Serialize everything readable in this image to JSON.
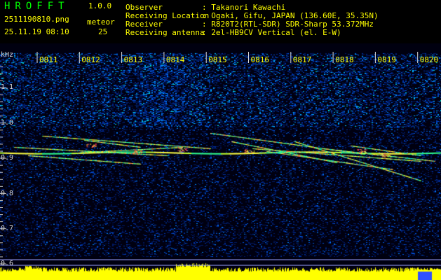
{
  "header": {
    "app_title": "HROFFT",
    "version": "1.0.0",
    "filename": "2511190810.png",
    "datetime": "25.11.19 08:10",
    "meteor_label": "meteor",
    "meteor_count": "25"
  },
  "info": {
    "labels": "Observer\nReceiving Location\nReceiver\nReceiving antenna",
    "values": ": Takanori Kawachi\n: Ogaki, Gifu, JAPAN (136.60E, 35.35N)\n: R820T2(RTL-SDR) SDR-Sharp 53.372MHz\n: 2el-HB9CV Vertical (el. E-W)"
  },
  "spectrogram": {
    "y_unit": "kHz",
    "y_ticks": [
      "1.1",
      "1.0",
      "0.9",
      "0.8",
      "0.7",
      "0.6"
    ],
    "x_ticks": [
      "0811",
      "0812",
      "0813",
      "0814",
      "0815",
      "0816",
      "0817",
      "0818",
      "0819",
      "0820"
    ],
    "colors": {
      "background": "#000000",
      "header_text": "#00ff00",
      "info_text": "#ffff00",
      "signal_band": "#ffff00",
      "axis": "#dddddd"
    }
  }
}
